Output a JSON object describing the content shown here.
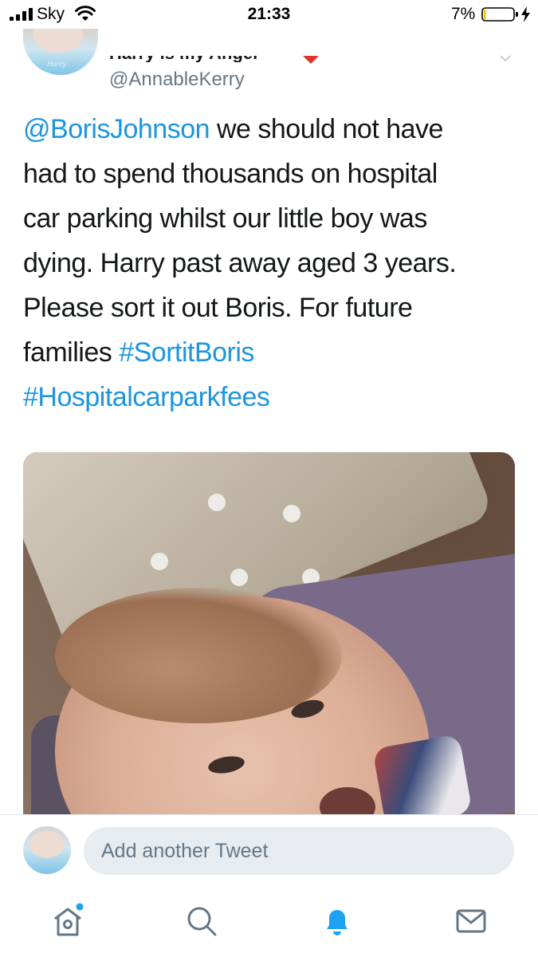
{
  "status_bar": {
    "carrier": "Sky",
    "time": "21:33",
    "battery_percent": "7%",
    "battery_level": 0.07,
    "icons": [
      "cellular-signal-icon",
      "wifi-icon",
      "battery-icon",
      "charging-bolt-icon"
    ]
  },
  "tweet": {
    "display_name": "Harry is my Angel",
    "handle": "@AnnableKerry",
    "mention": "@BorisJohnson",
    "body_lines": [
      " we should not have",
      "had to spend thousands on hospital",
      "car parking whilst our little boy was",
      "dying. Harry past away aged 3 years.",
      "Please sort it out Boris. For future"
    ],
    "line6_prefix": "families ",
    "hashtag1": "#SortitBoris",
    "hashtag2": "#Hospitalcarparkfees",
    "avatar_caption": "Harry"
  },
  "reply": {
    "placeholder": "Add another Tweet"
  },
  "tab_bar": {
    "tabs": [
      {
        "name": "home-icon",
        "active": false,
        "has_dot": true
      },
      {
        "name": "search-icon",
        "active": false
      },
      {
        "name": "notifications-icon",
        "active": true
      },
      {
        "name": "messages-icon",
        "active": false
      }
    ]
  },
  "colors": {
    "link": "#1b95e0",
    "text": "#14171a",
    "secondary": "#657786",
    "active_tab": "#1da1f2",
    "compose_bg": "#e6ecf0"
  }
}
